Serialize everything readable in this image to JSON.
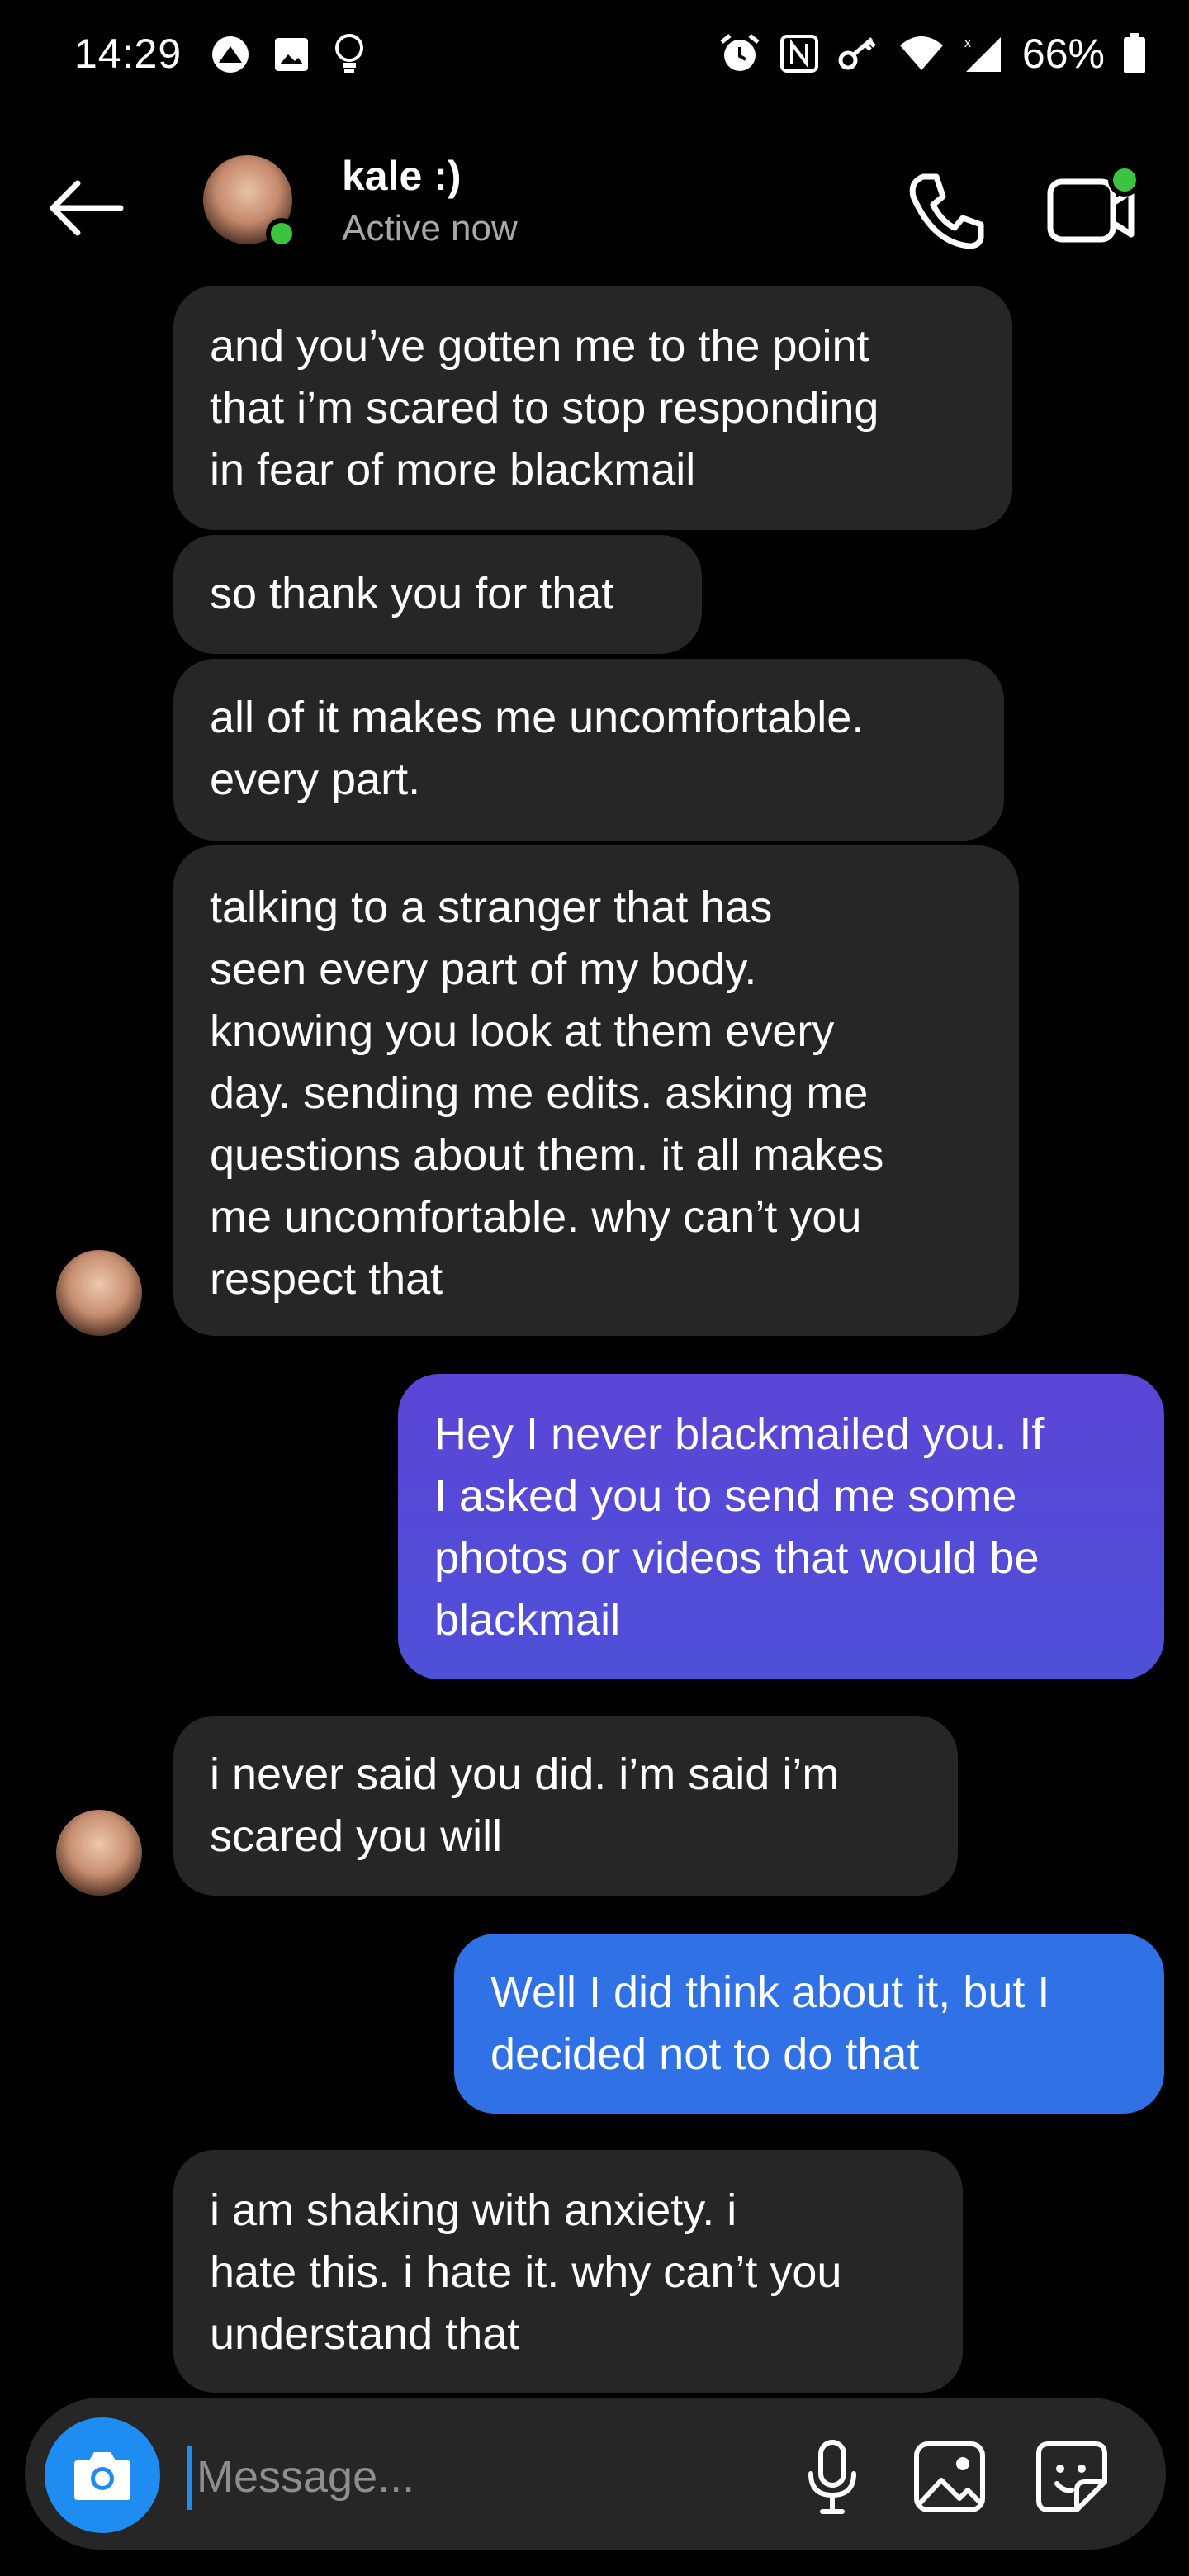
{
  "status_bar": {
    "time": "14:29",
    "battery": "66%",
    "icons_left": [
      "app-notification-icon",
      "image-icon",
      "lightbulb-icon"
    ],
    "icons_right": [
      "alarm-icon",
      "nfc-icon",
      "key-icon",
      "wifi-icon",
      "signal-icon",
      "battery-icon"
    ]
  },
  "header": {
    "contact_name": "kale :)",
    "contact_status": "Active now"
  },
  "messages": [
    {
      "dir": "in",
      "text": "and you’ve gotten me to the point\nthat i’m scared to stop responding\nin fear of more blackmail"
    },
    {
      "dir": "in",
      "text": "so thank you for that"
    },
    {
      "dir": "in",
      "text": "all of it makes me uncomfortable.\nevery part."
    },
    {
      "dir": "in",
      "text": "talking to a stranger that has\nseen every part of my body.\nknowing you look at them every\nday. sending me edits. asking me\nquestions about them. it all makes\nme uncomfortable. why can’t you\nrespect that"
    },
    {
      "dir": "out",
      "text": "Hey I never blackmailed you. If\nI asked you to send me some\nphotos or videos that would be\nblackmail"
    },
    {
      "dir": "in",
      "text": "i never said you did. i’m said i’m\nscared you will"
    },
    {
      "dir": "out",
      "text": "Well I did think about it, but I\ndecided not to do that"
    },
    {
      "dir": "in",
      "text": "i am shaking with anxiety. i\nhate this. i hate it. why can’t you\nunderstand that"
    }
  ],
  "composer": {
    "placeholder": "Message..."
  },
  "colors": {
    "incoming_bubble": "#262626",
    "outgoing_purple": "#5b45d6",
    "outgoing_blue": "#3072e6",
    "accent": "#1e8cf0",
    "online": "#3ac440"
  }
}
